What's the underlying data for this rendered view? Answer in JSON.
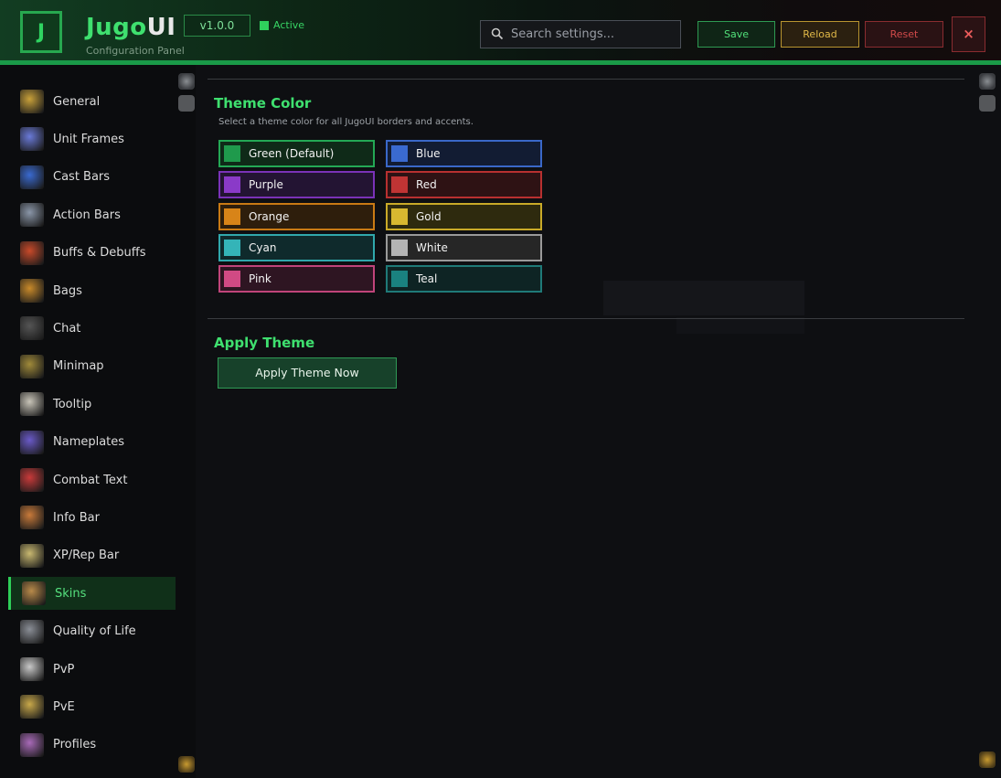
{
  "header": {
    "brand_main": "Jugo",
    "brand_accent": "UI",
    "subtitle": "Configuration Panel",
    "logo_letter": "J",
    "version": "v1.0.0",
    "status": "Active",
    "search_placeholder": "Search settings...",
    "save_label": "Save",
    "reload_label": "Reload",
    "reset_label": "Reset",
    "close_label": "×"
  },
  "sidebar": {
    "items": [
      {
        "label": "General",
        "icon": "cog-icon"
      },
      {
        "label": "Unit Frames",
        "icon": "unit-frames-icon"
      },
      {
        "label": "Cast Bars",
        "icon": "cast-bars-icon"
      },
      {
        "label": "Action Bars",
        "icon": "action-bars-icon"
      },
      {
        "label": "Buffs & Debuffs",
        "icon": "buffs-icon"
      },
      {
        "label": "Bags",
        "icon": "bag-icon"
      },
      {
        "label": "Chat",
        "icon": "chat-icon"
      },
      {
        "label": "Minimap",
        "icon": "minimap-icon"
      },
      {
        "label": "Tooltip",
        "icon": "tooltip-icon"
      },
      {
        "label": "Nameplates",
        "icon": "nameplates-icon"
      },
      {
        "label": "Combat Text",
        "icon": "combat-text-icon"
      },
      {
        "label": "Info Bar",
        "icon": "info-bar-icon"
      },
      {
        "label": "XP/Rep Bar",
        "icon": "xp-rep-icon"
      },
      {
        "label": "Skins",
        "icon": "skins-icon",
        "active": true
      },
      {
        "label": "Quality of Life",
        "icon": "quality-of-life-icon"
      },
      {
        "label": "PvP",
        "icon": "pvp-icon"
      },
      {
        "label": "PvE",
        "icon": "pve-icon"
      },
      {
        "label": "Profiles",
        "icon": "profiles-icon"
      }
    ]
  },
  "main": {
    "theme_title": "Theme Color",
    "theme_desc": "Select a theme color for all JugoUI borders and accents.",
    "swatches": [
      {
        "label": "Green (Default)",
        "color": "#1f9a4c",
        "border": "#24a855",
        "bg": "#0f2a18"
      },
      {
        "label": "Blue",
        "color": "#3a6ad0",
        "border": "#3a68c8",
        "bg": "#121c33"
      },
      {
        "label": "Purple",
        "color": "#8a3ac8",
        "border": "#7a32b8",
        "bg": "#231433"
      },
      {
        "label": "Red",
        "color": "#c03434",
        "border": "#b83030",
        "bg": "#2e1214"
      },
      {
        "label": "Orange",
        "color": "#d88418",
        "border": "#c97a14",
        "bg": "#2e1e0c"
      },
      {
        "label": "Gold",
        "color": "#d8b830",
        "border": "#c9aa28",
        "bg": "#2e2a0e"
      },
      {
        "label": "Cyan",
        "color": "#34b4b8",
        "border": "#30a8ac",
        "bg": "#0f2a2c"
      },
      {
        "label": "White",
        "color": "#b4b4b4",
        "border": "#9a9a9a",
        "bg": "#262626"
      },
      {
        "label": "Pink",
        "color": "#d04a84",
        "border": "#c0447a",
        "bg": "#2e1522"
      },
      {
        "label": "Teal",
        "color": "#1a8280",
        "border": "#1f7a78",
        "bg": "#0e2424"
      }
    ],
    "apply_title": "Apply Theme",
    "apply_button": "Apply Theme Now"
  }
}
